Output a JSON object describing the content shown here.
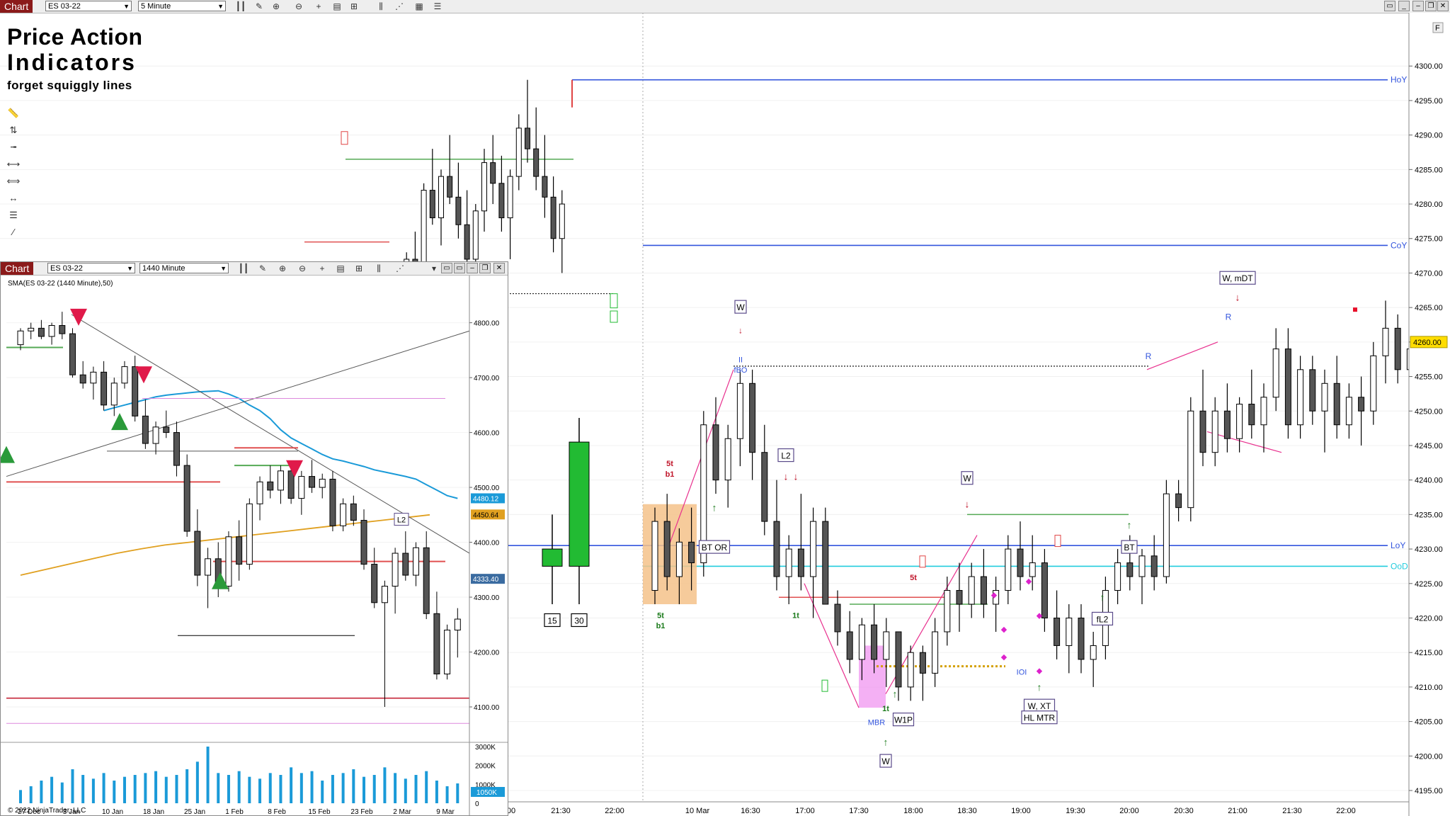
{
  "main_toolbar": {
    "tab": "Chart",
    "instrument": "ES 03-22",
    "interval": "5 Minute"
  },
  "branding": {
    "line1": "Price Action",
    "line2": "Indicators",
    "line3": "forget squiggly lines"
  },
  "inset_toolbar": {
    "tab": "Chart",
    "instrument": "ES 03-22",
    "interval": "1440 Minute"
  },
  "colors": {
    "bull": "#22bb33",
    "bear": "#000000",
    "levels_blue": "#3355dd",
    "oo_cyan": "#22ccdd",
    "support_red": "#e05050",
    "support_green": "#55aa55",
    "accent_pink": "#e8308e",
    "price_yellow": "#ffdd00"
  },
  "chart_data": [
    {
      "type": "candlestick",
      "title": "ES 03-22 5 Minute",
      "ylim": [
        4195,
        4303
      ],
      "y_ticks": [
        "4300.00",
        "4295.00",
        "4290.00",
        "4285.00",
        "4280.00",
        "4275.00",
        "4270.00",
        "4265.00",
        "4260.00",
        "4255.00",
        "4250.00",
        "4245.00",
        "4240.00",
        "4235.00",
        "4230.00",
        "4225.00",
        "4220.00",
        "4215.00",
        "4210.00",
        "4205.00",
        "4200.00",
        "4195.00"
      ],
      "current_price": "4260.00",
      "x_ticks": [
        "00",
        "21:30",
        "22:00",
        "10 Mar",
        "16:30",
        "17:00",
        "17:30",
        "18:00",
        "18:30",
        "19:00",
        "19:30",
        "20:00",
        "20:30",
        "21:00",
        "21:30",
        "22:00"
      ],
      "levels": [
        {
          "label": "HoY",
          "value": 4298
        },
        {
          "label": "CoY",
          "value": 4274
        },
        {
          "label": "LoY",
          "value": 4230.5
        },
        {
          "label": "OoD",
          "value": 4227.5
        }
      ],
      "annotations": [
        "W",
        "II",
        "fBO",
        "BT OR",
        "L2",
        "5t",
        "b1",
        "5t",
        "b1",
        "1t",
        "MBR",
        "1t",
        "W1P",
        "W",
        "5t",
        "W",
        "IOI",
        "W, XT",
        "HL MTR",
        "fL2",
        "BT",
        "R",
        "R",
        "W, mDT",
        "15",
        "30",
        "F"
      ],
      "series": [
        {
          "name": "prior session",
          "ohlc": [
            [
              4266,
              4268,
              4264,
              4265
            ],
            [
              4265,
              4273,
              4264,
              4272
            ],
            [
              4272,
              4276,
              4270,
              4271
            ],
            [
              4271,
              4283,
              4270,
              4282
            ],
            [
              4282,
              4288,
              4277,
              4278
            ],
            [
              4278,
              4285,
              4274,
              4284
            ],
            [
              4284,
              4290,
              4280,
              4281
            ],
            [
              4281,
              4286,
              4275,
              4277
            ],
            [
              4277,
              4282,
              4270,
              4272
            ],
            [
              4272,
              4280,
              4268,
              4279
            ],
            [
              4279,
              4288,
              4276,
              4286
            ],
            [
              4286,
              4290,
              4280,
              4283
            ],
            [
              4283,
              4287,
              4276,
              4278
            ],
            [
              4278,
              4285,
              4272,
              4284
            ],
            [
              4284,
              4293,
              4282,
              4291
            ],
            [
              4291,
              4298,
              4286,
              4288
            ],
            [
              4288,
              4294,
              4282,
              4284
            ],
            [
              4284,
              4290,
              4278,
              4281
            ],
            [
              4281,
              4284,
              4273,
              4275
            ],
            [
              4275,
              4282,
              4270,
              4280
            ]
          ]
        },
        {
          "name": "10 Mar",
          "ohlc": [
            [
              4224,
              4236,
              4222,
              4234
            ],
            [
              4234,
              4238,
              4224,
              4226
            ],
            [
              4226,
              4233,
              4222,
              4231
            ],
            [
              4231,
              4236,
              4224,
              4228
            ],
            [
              4228,
              4250,
              4226,
              4248
            ],
            [
              4248,
              4252,
              4238,
              4240
            ],
            [
              4240,
              4248,
              4236,
              4246
            ],
            [
              4246,
              4256,
              4242,
              4254
            ],
            [
              4254,
              4256,
              4240,
              4244
            ],
            [
              4244,
              4248,
              4232,
              4234
            ],
            [
              4234,
              4240,
              4224,
              4226
            ],
            [
              4226,
              4232,
              4222,
              4230
            ],
            [
              4230,
              4238,
              4224,
              4226
            ],
            [
              4226,
              4236,
              4220,
              4234
            ],
            [
              4234,
              4236,
              4222,
              4222
            ],
            [
              4222,
              4224,
              4216,
              4218
            ],
            [
              4218,
              4221,
              4212,
              4214
            ],
            [
              4214,
              4220,
              4211,
              4219
            ],
            [
              4219,
              4222,
              4212,
              4214
            ],
            [
              4214,
              4220,
              4210,
              4218
            ],
            [
              4218,
              4218,
              4208,
              4210
            ],
            [
              4210,
              4216,
              4208,
              4215
            ],
            [
              4215,
              4216,
              4208,
              4212
            ],
            [
              4212,
              4220,
              4210,
              4218
            ],
            [
              4218,
              4226,
              4216,
              4224
            ],
            [
              4224,
              4228,
              4218,
              4222
            ],
            [
              4222,
              4228,
              4220,
              4226
            ],
            [
              4226,
              4230,
              4220,
              4222
            ],
            [
              4222,
              4226,
              4218,
              4224
            ],
            [
              4224,
              4232,
              4222,
              4230
            ],
            [
              4230,
              4234,
              4224,
              4226
            ],
            [
              4226,
              4232,
              4224,
              4228
            ],
            [
              4228,
              4230,
              4218,
              4220
            ],
            [
              4220,
              4224,
              4214,
              4216
            ],
            [
              4216,
              4222,
              4212,
              4220
            ],
            [
              4220,
              4222,
              4212,
              4214
            ],
            [
              4214,
              4218,
              4210,
              4216
            ],
            [
              4216,
              4226,
              4214,
              4224
            ],
            [
              4224,
              4230,
              4222,
              4228
            ],
            [
              4228,
              4232,
              4224,
              4226
            ],
            [
              4226,
              4230,
              4222,
              4229
            ],
            [
              4229,
              4232,
              4224,
              4226
            ],
            [
              4226,
              4240,
              4225,
              4238
            ],
            [
              4238,
              4240,
              4234,
              4236
            ],
            [
              4236,
              4252,
              4234,
              4250
            ],
            [
              4250,
              4256,
              4242,
              4244
            ],
            [
              4244,
              4252,
              4242,
              4250
            ],
            [
              4250,
              4254,
              4244,
              4246
            ],
            [
              4246,
              4252,
              4244,
              4251
            ],
            [
              4251,
              4256,
              4246,
              4248
            ],
            [
              4248,
              4254,
              4244,
              4252
            ],
            [
              4252,
              4262,
              4250,
              4259
            ],
            [
              4259,
              4262,
              4246,
              4248
            ],
            [
              4248,
              4258,
              4246,
              4256
            ],
            [
              4256,
              4258,
              4248,
              4250
            ],
            [
              4250,
              4256,
              4244,
              4254
            ],
            [
              4254,
              4258,
              4246,
              4248
            ],
            [
              4248,
              4254,
              4246,
              4252
            ],
            [
              4252,
              4255,
              4245,
              4250
            ],
            [
              4250,
              4260,
              4248,
              4258
            ],
            [
              4258,
              4266,
              4254,
              4262
            ],
            [
              4262,
              4264,
              4254,
              4256
            ],
            [
              4256,
              4260,
              4254,
              4259
            ]
          ]
        }
      ]
    },
    {
      "type": "candlestick",
      "title": "SMA(ES 03-22 (1440 Minute),50)",
      "ylim": [
        4060,
        4855
      ],
      "y_ticks": [
        "4800.00",
        "4700.00",
        "4600.00",
        "4500.00",
        "4400.00",
        "4300.00",
        "4200.00",
        "4100.00"
      ],
      "price_labels": [
        "4480.12",
        "4450.64",
        "4333.40"
      ],
      "x_ticks": [
        "27 Dec",
        "3 Jan",
        "10 Jan",
        "18 Jan",
        "25 Jan",
        "1 Feb",
        "8 Feb",
        "15 Feb",
        "23 Feb",
        "2 Mar",
        "9 Mar"
      ],
      "annotations": [
        "L2"
      ],
      "ohlc": [
        [
          4760,
          4790,
          4750,
          4785
        ],
        [
          4785,
          4800,
          4770,
          4790
        ],
        [
          4790,
          4805,
          4770,
          4775
        ],
        [
          4775,
          4800,
          4760,
          4795
        ],
        [
          4795,
          4820,
          4770,
          4780
        ],
        [
          4780,
          4790,
          4700,
          4705
        ],
        [
          4705,
          4730,
          4680,
          4690
        ],
        [
          4690,
          4720,
          4660,
          4710
        ],
        [
          4710,
          4730,
          4640,
          4650
        ],
        [
          4650,
          4700,
          4630,
          4690
        ],
        [
          4690,
          4730,
          4680,
          4720
        ],
        [
          4720,
          4740,
          4620,
          4630
        ],
        [
          4630,
          4660,
          4570,
          4580
        ],
        [
          4580,
          4620,
          4560,
          4610
        ],
        [
          4610,
          4640,
          4590,
          4600
        ],
        [
          4600,
          4620,
          4520,
          4540
        ],
        [
          4540,
          4560,
          4410,
          4420
        ],
        [
          4420,
          4460,
          4320,
          4340
        ],
        [
          4340,
          4390,
          4280,
          4370
        ],
        [
          4370,
          4400,
          4300,
          4320
        ],
        [
          4320,
          4420,
          4310,
          4410
        ],
        [
          4410,
          4440,
          4330,
          4360
        ],
        [
          4360,
          4480,
          4350,
          4470
        ],
        [
          4470,
          4520,
          4440,
          4510
        ],
        [
          4510,
          4540,
          4480,
          4495
        ],
        [
          4495,
          4540,
          4470,
          4530
        ],
        [
          4530,
          4545,
          4470,
          4480
        ],
        [
          4480,
          4530,
          4450,
          4520
        ],
        [
          4520,
          4550,
          4490,
          4500
        ],
        [
          4500,
          4525,
          4480,
          4515
        ],
        [
          4515,
          4530,
          4420,
          4430
        ],
        [
          4430,
          4480,
          4420,
          4470
        ],
        [
          4470,
          4485,
          4430,
          4440
        ],
        [
          4440,
          4460,
          4350,
          4360
        ],
        [
          4360,
          4390,
          4280,
          4290
        ],
        [
          4290,
          4330,
          4100,
          4320
        ],
        [
          4320,
          4390,
          4270,
          4380
        ],
        [
          4380,
          4420,
          4330,
          4340
        ],
        [
          4340,
          4400,
          4320,
          4390
        ],
        [
          4390,
          4420,
          4260,
          4270
        ],
        [
          4270,
          4310,
          4150,
          4160
        ],
        [
          4160,
          4250,
          4150,
          4240
        ],
        [
          4240,
          4280,
          4190,
          4260
        ]
      ],
      "volume_ticks": [
        "3000K",
        "2000K",
        "1000K",
        "0"
      ],
      "volume_label": "1050K",
      "copyright": "© 2022 NinjaTrader, LLC"
    }
  ]
}
